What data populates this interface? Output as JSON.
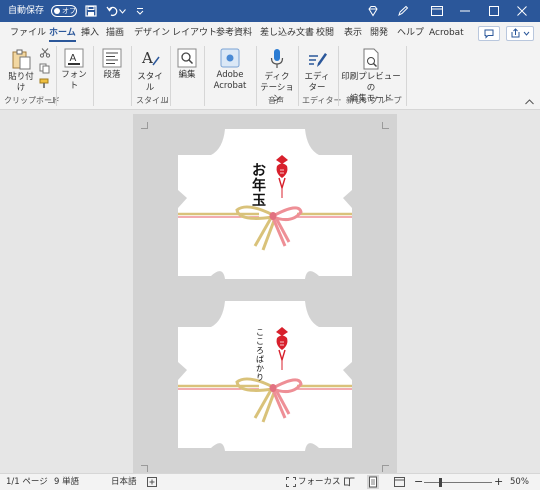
{
  "titlebar": {
    "autosave_label": "自動保存",
    "autosave_state": "オフ"
  },
  "tabs": [
    "ファイル",
    "ホーム",
    "挿入",
    "描画",
    "デザイン",
    "レイアウト",
    "参考資料",
    "差し込み文書",
    "校閲",
    "表示",
    "開発",
    "ヘルプ",
    "Acrobat"
  ],
  "active_tab": "ホーム",
  "ribbon": {
    "paste": "貼り付け",
    "font": "フォント",
    "paragraph": "段落",
    "styles": "スタイル",
    "editing": "編集",
    "adobe_line1": "Adobe",
    "adobe_line2": "Acrobat",
    "dictate_line1": "ディク",
    "dictate_line2": "テーション",
    "editor_line1": "エディ",
    "editor_line2": "ター",
    "preview_line1": "印刷プレビューの",
    "preview_line2": "編集モード",
    "groups": {
      "clipboard": "クリップボード",
      "style": "スタイル",
      "voice": "音声",
      "editor": "エディター",
      "newgroup": "新しいグループ"
    }
  },
  "envelopes": {
    "top_text": "お年玉",
    "bottom_text": "こころばかり"
  },
  "status": {
    "page": "1/1 ページ",
    "words": "9 単語",
    "language": "日本語",
    "focus": "フォーカス",
    "zoom": "50%"
  },
  "colors": {
    "titlebar": "#2b579a",
    "ribbon": "#f3f3f3",
    "cord_gold": "#d9c27a",
    "cord_pink": "#ee8f96",
    "seal_red": "#d8202c"
  }
}
